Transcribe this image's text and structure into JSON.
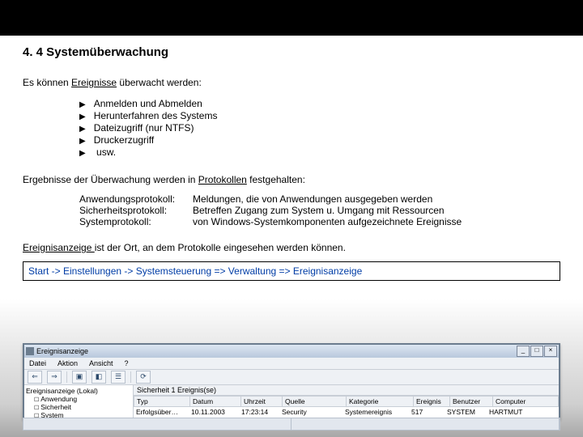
{
  "heading": "4. 4  Systemüberwachung",
  "intro_pre": "Es können ",
  "intro_u": "Ereignisse",
  "intro_post": " überwacht werden:",
  "bullets": [
    "Anmelden und Abmelden",
    "Herunterfahren des Systems",
    "Dateizugriff (nur NTFS)",
    "Druckerzugriff",
    " usw."
  ],
  "res_pre": "Ergebnisse der Überwachung werden in ",
  "res_u": "Protokollen",
  "res_post": " festgehalten:",
  "protos": [
    {
      "k": "Anwendungsprotokoll:",
      "v": "Meldungen, die von Anwendungen ausgegeben werden"
    },
    {
      "k": "Sicherheitsprotokoll:",
      "v": "Betreffen Zugang zum System u. Umgang mit Ressourcen"
    },
    {
      "k": "Systemprotokoll:",
      "v": "von Windows-Systemkomponenten aufgezeichnete Ereignisse"
    }
  ],
  "loc_u": "Ereignisanzeige ",
  "loc_post": "ist der Ort, an dem Protokolle eingesehen werden können.",
  "path": "Start -> Einstellungen -> Systemsteuerung => Verwaltung =>  Ereignisanzeige",
  "win": {
    "title": "Ereignisanzeige",
    "menu": [
      "Datei",
      "Aktion",
      "Ansicht",
      "?"
    ],
    "tree_root": "Ereignisanzeige (Lokal)",
    "tree": [
      "Anwendung",
      "Sicherheit",
      "System"
    ],
    "list_title": "Sicherheit  1 Ereignis(se)",
    "cols": [
      "Typ",
      "Datum",
      "Uhrzeit",
      "Quelle",
      "Kategorie",
      "Ereignis",
      "Benutzer",
      "Computer"
    ],
    "row": [
      "Erfolgsüber…",
      "10.11.2003",
      "17:23:14",
      "Security",
      "Systemereignis",
      "517",
      "SYSTEM",
      "HARTMUT"
    ]
  }
}
